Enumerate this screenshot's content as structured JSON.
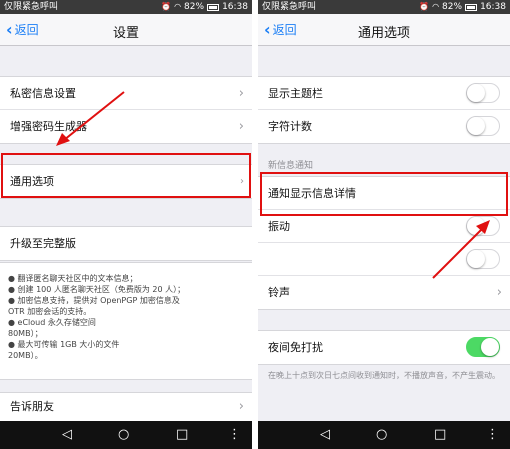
{
  "status_bar": {
    "carrier": "仅限紧急呼叫",
    "battery": "82%",
    "time": "16:38"
  },
  "left_screen": {
    "back_label": "返回",
    "title": "设置",
    "rows_group1": [
      "私密信息设置",
      "增强密码生成器"
    ],
    "highlighted_row": "通用选项",
    "upgrade_title": "升级至完整版",
    "upgrade_bullets": [
      "● 翻译匿名聊天社区中的文本信息；",
      "● 创建 100 人匿名聊天社区（免费版为 20 人）；",
      "● 加密信息支持，提供对 OpenPGP 加密信息及",
      "OTR 加密会话的支持。",
      "● eCloud 永久存储空间",
      "80MB）；",
      "● 最大可传输 1GB 大小的文件",
      "20MB）。"
    ],
    "bottom_row": "告诉朋友"
  },
  "right_screen": {
    "back_label": "返回",
    "title": "通用选项",
    "rows_group1": [
      "显示主题栏",
      "字符计数"
    ],
    "section_label": "新信息通知",
    "highlighted_row": "通知显示信息详情",
    "vibrate_row": "振动",
    "ringtone_row": "铃声",
    "night_row": "夜间免打扰",
    "night_note": "在晚上十点到次日七点间收到通知时，不播放声音，不产生震动。"
  },
  "toggles": {
    "show_theme_bar": false,
    "char_count": false,
    "notification_detail": false,
    "vibrate": false,
    "unnamed_toggle": false,
    "night_mode": true
  },
  "softkeys": {
    "back": "◁",
    "home": "○",
    "recents": "□",
    "menu": "⋮"
  },
  "colors": {
    "highlight": "#e01010",
    "accent": "#1a7ef5",
    "toggle_on": "#4cd964"
  },
  "icons": [
    "back-chevron-icon",
    "chevron-right-icon",
    "wifi-icon",
    "battery-icon",
    "alarm-icon"
  ]
}
